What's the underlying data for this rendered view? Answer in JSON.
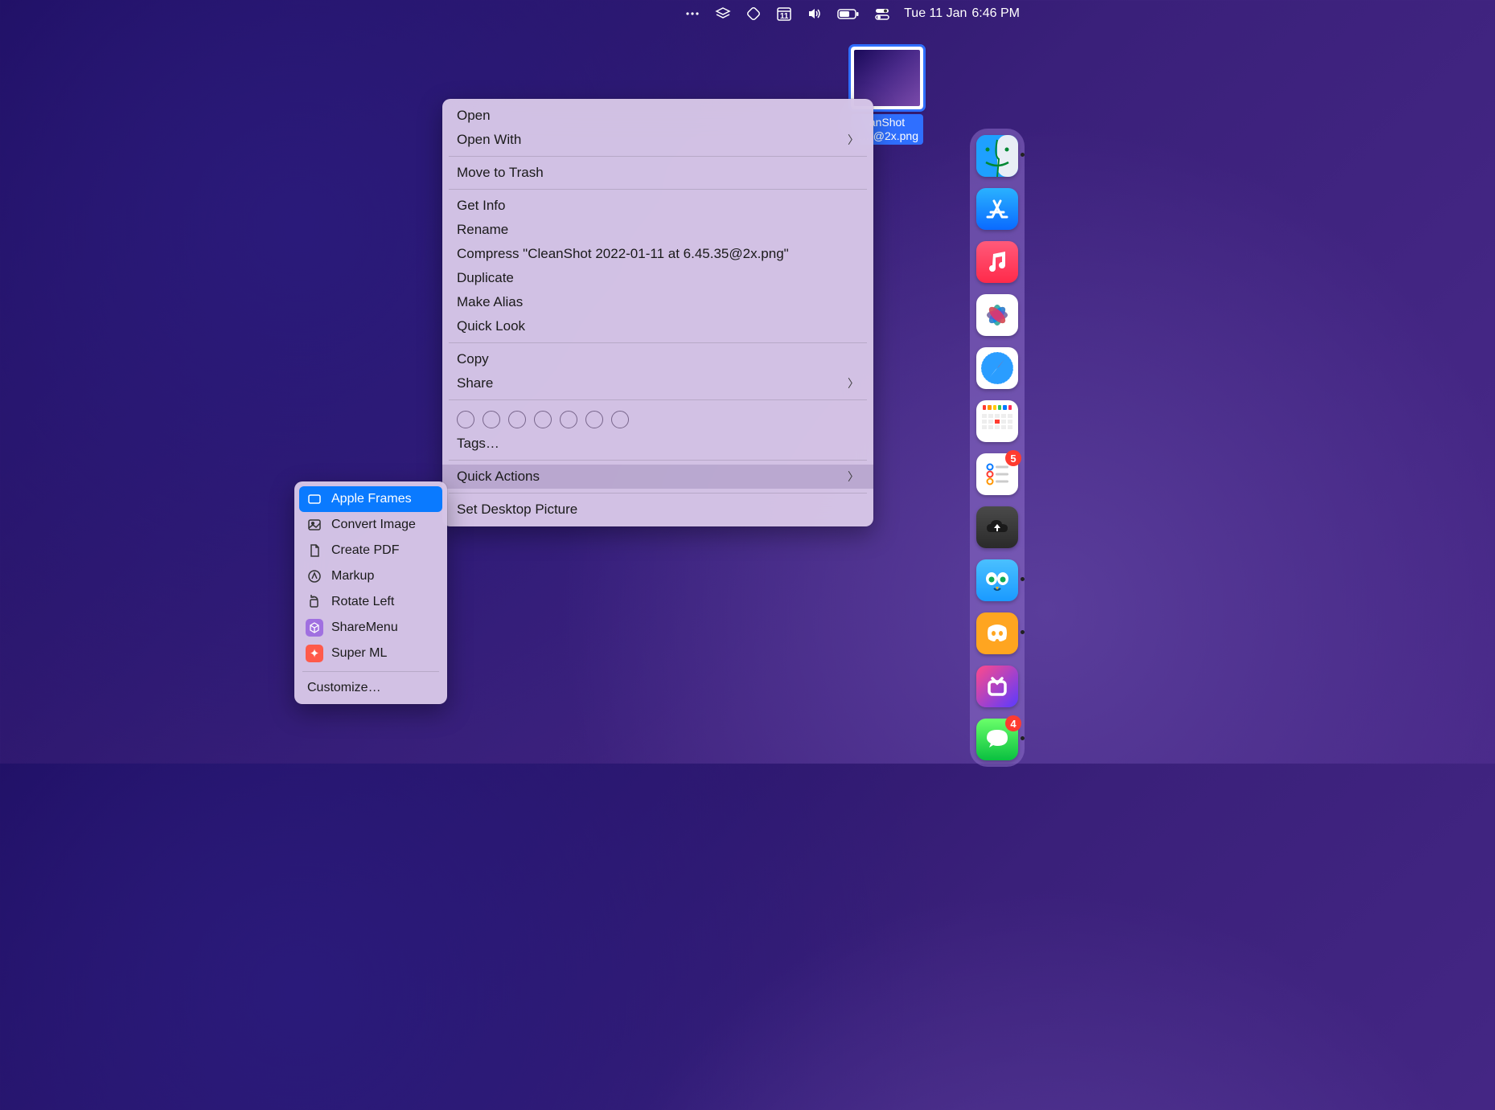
{
  "menubar": {
    "date": "Tue 11 Jan",
    "time": "6:46 PM",
    "calendar_day": "11"
  },
  "desktop": {
    "file_label_line1": "anShot",
    "file_label_line2": "1…@2x.png"
  },
  "context_menu": {
    "open": "Open",
    "open_with": "Open With",
    "move_to_trash": "Move to Trash",
    "get_info": "Get Info",
    "rename": "Rename",
    "compress": "Compress \"CleanShot 2022-01-11 at 6.45.35@2x.png\"",
    "duplicate": "Duplicate",
    "make_alias": "Make Alias",
    "quick_look": "Quick Look",
    "copy": "Copy",
    "share": "Share",
    "tags": "Tags…",
    "quick_actions": "Quick Actions",
    "set_desktop": "Set Desktop Picture"
  },
  "quick_actions_submenu": {
    "items": [
      {
        "label": "Apple Frames",
        "icon": "frame"
      },
      {
        "label": "Convert Image",
        "icon": "image"
      },
      {
        "label": "Create PDF",
        "icon": "doc"
      },
      {
        "label": "Markup",
        "icon": "markup"
      },
      {
        "label": "Rotate Left",
        "icon": "rotate"
      },
      {
        "label": "ShareMenu",
        "icon": "cube"
      },
      {
        "label": "Super ML",
        "icon": "sparkle"
      }
    ],
    "customize": "Customize…"
  },
  "dock": {
    "items": [
      {
        "name": "finder",
        "running": true
      },
      {
        "name": "app-store"
      },
      {
        "name": "music"
      },
      {
        "name": "photos"
      },
      {
        "name": "safari"
      },
      {
        "name": "calendar"
      },
      {
        "name": "reminders",
        "badge": "5"
      },
      {
        "name": "cloud"
      },
      {
        "name": "tweetbot",
        "running": true
      },
      {
        "name": "discord",
        "running": true
      },
      {
        "name": "shortcuts"
      },
      {
        "name": "messages",
        "running": true,
        "badge": "4"
      }
    ]
  }
}
